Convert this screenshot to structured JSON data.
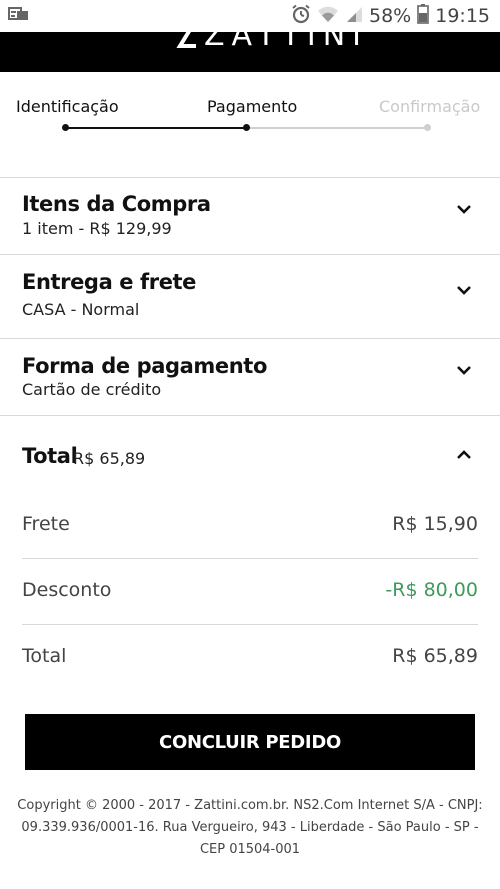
{
  "status_bar": {
    "battery_percent": "58%",
    "time": "19:15",
    "icons": [
      "notification-icon",
      "alarm-icon",
      "wifi-icon",
      "signal-icon",
      "battery-icon"
    ]
  },
  "header": {
    "logo_text": "ZATTINI"
  },
  "steps": {
    "items": [
      {
        "label": "Identificação",
        "state": "done"
      },
      {
        "label": "Pagamento",
        "state": "current"
      },
      {
        "label": "Confirmação",
        "state": "pending"
      }
    ]
  },
  "sections": {
    "items": {
      "title": "Itens da Compra",
      "subtitle": "1 item - R$ 129,99"
    },
    "delivery": {
      "title": "Entrega e frete",
      "subtitle": "CASA - Normal"
    },
    "payment": {
      "title": "Forma de pagamento",
      "subtitle": "Cartão de crédito"
    },
    "total": {
      "title": "Total",
      "value": "R$ 65,89"
    }
  },
  "summary": {
    "shipping": {
      "label": "Frete",
      "value": "R$ 15,90"
    },
    "discount": {
      "label": "Desconto",
      "value": "-R$ 80,00"
    },
    "total": {
      "label": "Total",
      "value": "R$ 65,89"
    }
  },
  "actions": {
    "submit_label": "CONCLUIR PEDIDO"
  },
  "footer": {
    "text": "Copyright © 2000 - 2017 - Zattini.com.br. NS2.Com Internet S/A - CNPJ: 09.339.936/0001-16. Rua Vergueiro, 943 - Liberdade - São Paulo - SP - CEP 01504-001"
  },
  "colors": {
    "brand": "#000000",
    "discount": "#3f9a5b",
    "inactive_step": "#c9c9c9"
  }
}
